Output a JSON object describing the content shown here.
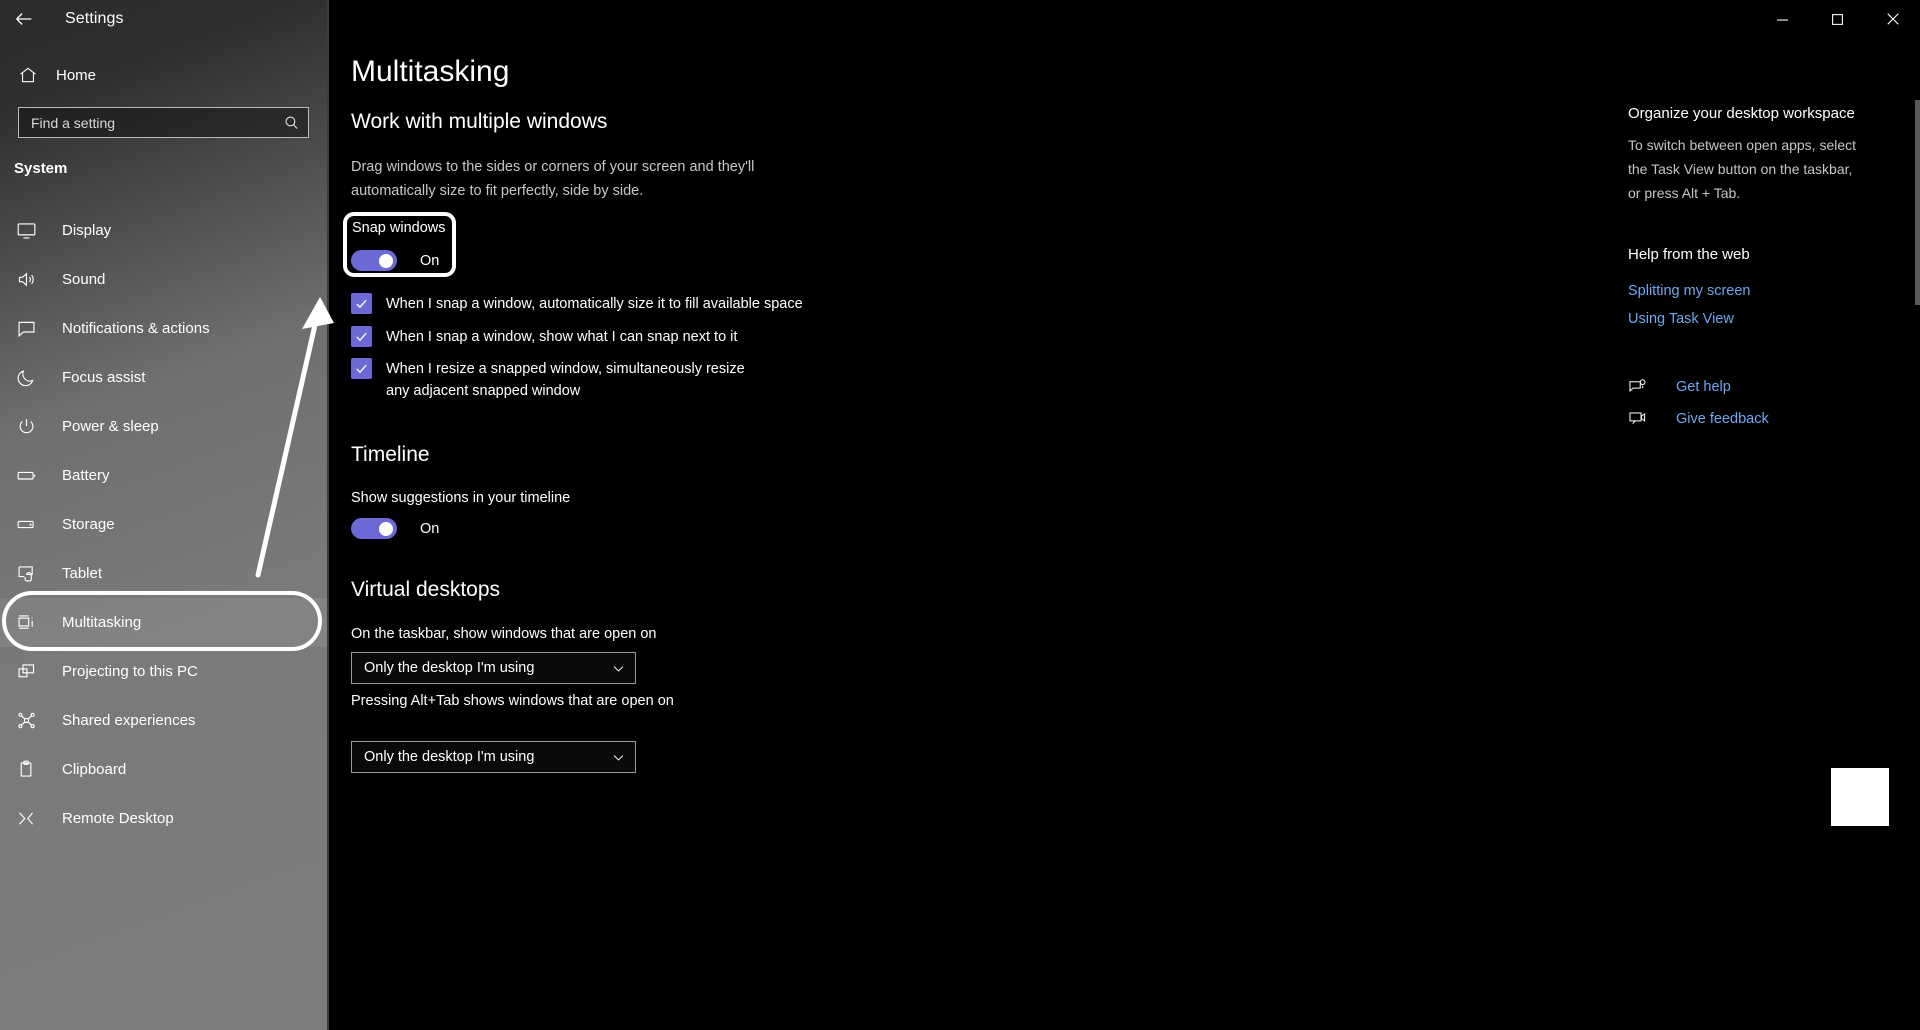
{
  "window": {
    "app_title": "Settings",
    "back_icon": "back-arrow-icon",
    "minimize_icon": "minimize-icon",
    "restore_icon": "restore-icon",
    "close_icon": "close-icon"
  },
  "sidebar": {
    "home_label": "Home",
    "home_icon": "home-icon",
    "search": {
      "placeholder": "Find a setting",
      "icon": "search-icon",
      "value": ""
    },
    "category": "System",
    "selected": "Multitasking",
    "items": [
      {
        "label": "Display",
        "icon": "monitor-icon"
      },
      {
        "label": "Sound",
        "icon": "speaker-icon"
      },
      {
        "label": "Notifications & actions",
        "icon": "chat-bubble-icon"
      },
      {
        "label": "Focus assist",
        "icon": "moon-icon"
      },
      {
        "label": "Power & sleep",
        "icon": "power-icon"
      },
      {
        "label": "Battery",
        "icon": "battery-icon"
      },
      {
        "label": "Storage",
        "icon": "drive-icon"
      },
      {
        "label": "Tablet",
        "icon": "tablet-icon"
      },
      {
        "label": "Multitasking",
        "icon": "multitasking-icon"
      },
      {
        "label": "Projecting to this PC",
        "icon": "projecting-icon"
      },
      {
        "label": "Shared experiences",
        "icon": "share-nodes-icon"
      },
      {
        "label": "Clipboard",
        "icon": "clipboard-icon"
      },
      {
        "label": "Remote Desktop",
        "icon": "remote-desktop-icon"
      }
    ]
  },
  "main": {
    "page_title": "Multitasking",
    "snap_section": {
      "heading": "Work with multiple windows",
      "description": "Drag windows to the sides or corners of your screen and they'll automatically size to fit perfectly, side by side.",
      "toggle_label": "Snap windows",
      "toggle_state": "On",
      "checkboxes": [
        "When I snap a window, automatically size it to fill available space",
        "When I snap a window, show what I can snap next to it",
        "When I resize a snapped window, simultaneously resize any adjacent snapped window"
      ]
    },
    "timeline_section": {
      "heading": "Timeline",
      "toggle_label": "Show suggestions in your timeline",
      "toggle_state": "On"
    },
    "virtual_desktops_section": {
      "heading": "Virtual desktops",
      "taskbar_label": "On the taskbar, show windows that are open on",
      "taskbar_value": "Only the desktop I'm using",
      "alttab_label": "Pressing Alt+Tab shows windows that are open on",
      "alttab_value": "Only the desktop I'm using",
      "chevron_icon": "chevron-down-icon"
    }
  },
  "right_panel": {
    "organize_heading": "Organize your desktop workspace",
    "organize_text": "To switch between open apps, select the Task View button on the taskbar, or press Alt + Tab.",
    "help_heading": "Help from the web",
    "web_links": [
      "Splitting my screen",
      "Using Task View"
    ],
    "actions": [
      {
        "label": "Get help",
        "icon": "get-help-icon"
      },
      {
        "label": "Give feedback",
        "icon": "give-feedback-icon"
      }
    ]
  },
  "colors": {
    "accent": "#6b69d6",
    "link": "#6ea8f0",
    "annotation": "#ffffff",
    "background": "#000000",
    "sidebar": "#7a7a7a"
  }
}
